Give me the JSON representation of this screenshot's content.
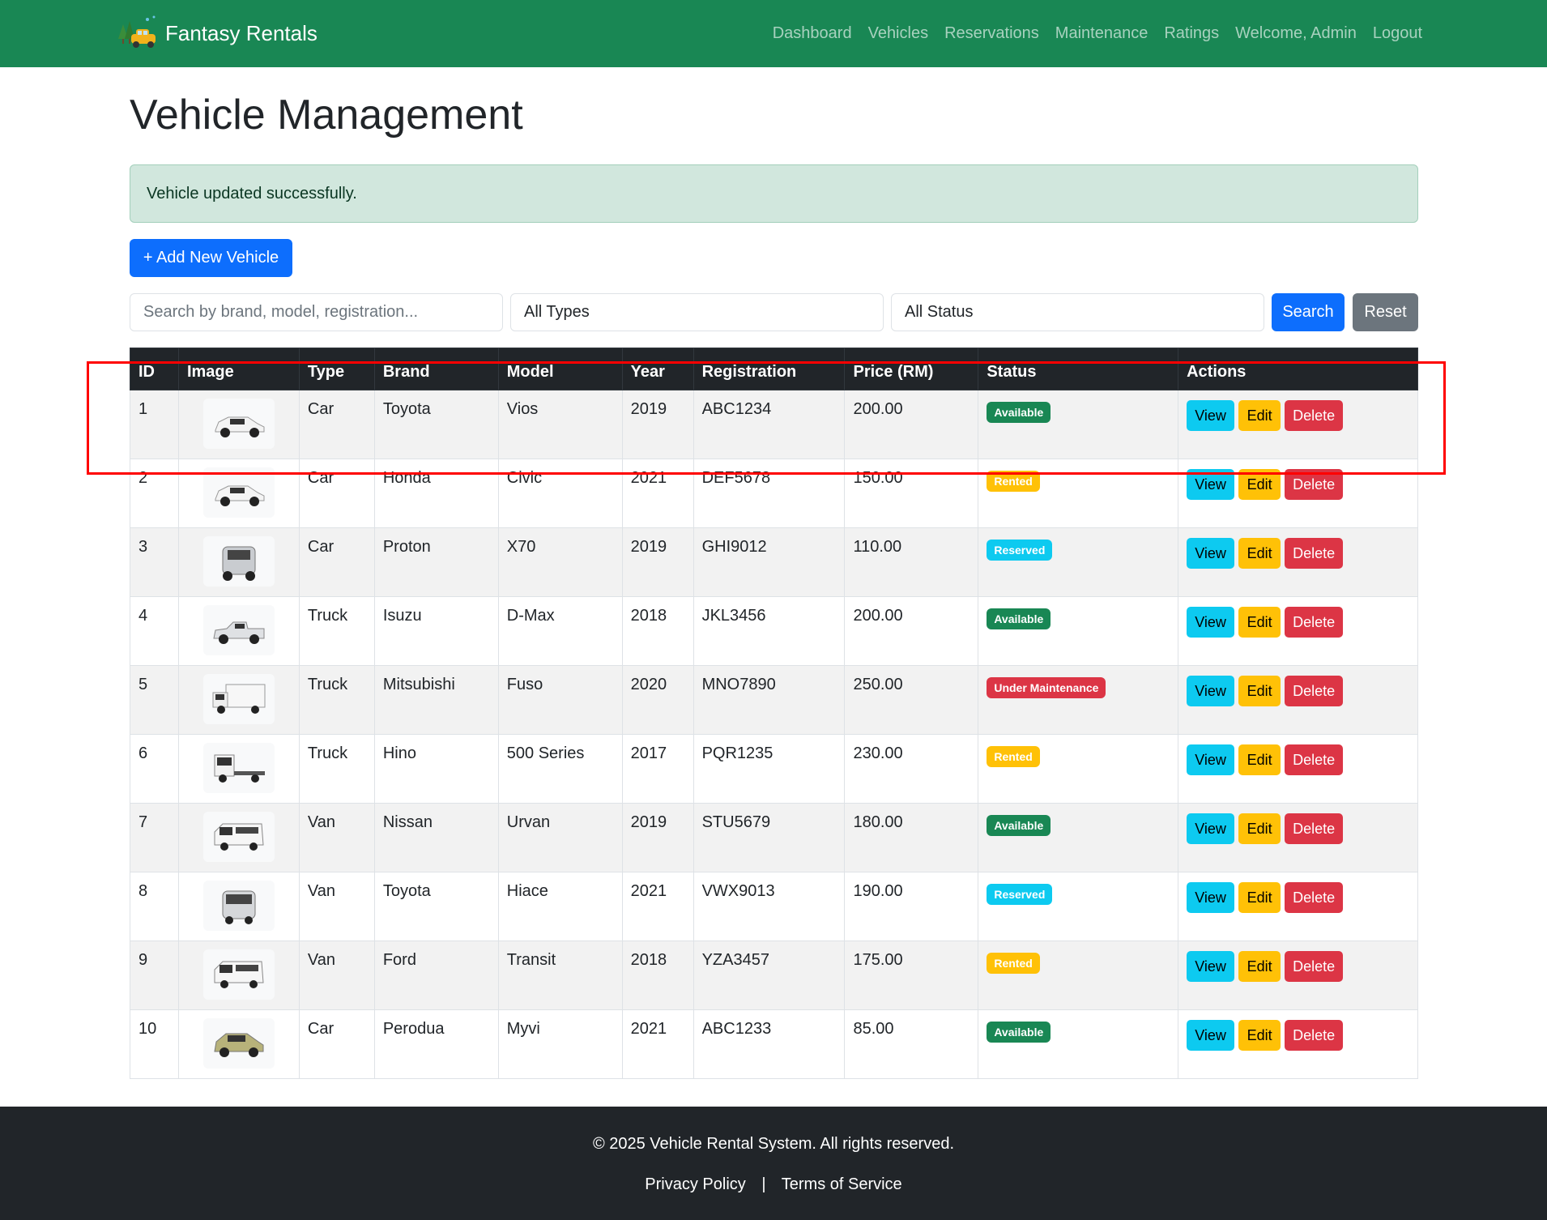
{
  "navbar": {
    "brand": "Fantasy Rentals",
    "links": [
      "Dashboard",
      "Vehicles",
      "Reservations",
      "Maintenance",
      "Ratings",
      "Welcome, Admin",
      "Logout"
    ],
    "color": "#198754"
  },
  "page": {
    "title": "Vehicle Management",
    "alert": "Vehicle updated successfully.",
    "add_button": "+ Add New Vehicle"
  },
  "filters": {
    "search_placeholder": "Search by brand, model, registration...",
    "type_value": "All Types",
    "status_value": "All Status",
    "search_button": "Search",
    "reset_button": "Reset"
  },
  "table": {
    "headers": [
      "ID",
      "Image",
      "Type",
      "Brand",
      "Model",
      "Year",
      "Registration",
      "Price (RM)",
      "Status",
      "Actions"
    ],
    "rows": [
      {
        "id": "1",
        "type": "Car",
        "brand": "Toyota",
        "model": "Vios",
        "year": "2019",
        "registration": "ABC1234",
        "price": "200.00",
        "status": "Available",
        "status_color": "green",
        "vehicle_icon": "sedan-white"
      },
      {
        "id": "2",
        "type": "Car",
        "brand": "Honda",
        "model": "Civic",
        "year": "2021",
        "registration": "DEF5678",
        "price": "150.00",
        "status": "Rented",
        "status_color": "yellow",
        "vehicle_icon": "sedan-white"
      },
      {
        "id": "3",
        "type": "Car",
        "brand": "Proton",
        "model": "X70",
        "year": "2019",
        "registration": "GHI9012",
        "price": "110.00",
        "status": "Reserved",
        "status_color": "cyan",
        "vehicle_icon": "suv-silver"
      },
      {
        "id": "4",
        "type": "Truck",
        "brand": "Isuzu",
        "model": "D-Max",
        "year": "2018",
        "registration": "JKL3456",
        "price": "200.00",
        "status": "Available",
        "status_color": "green",
        "vehicle_icon": "pickup-silver"
      },
      {
        "id": "5",
        "type": "Truck",
        "brand": "Mitsubishi",
        "model": "Fuso",
        "year": "2020",
        "registration": "MNO7890",
        "price": "250.00",
        "status": "Under Maintenance",
        "status_color": "red",
        "vehicle_icon": "box-truck"
      },
      {
        "id": "6",
        "type": "Truck",
        "brand": "Hino",
        "model": "500 Series",
        "year": "2017",
        "registration": "PQR1235",
        "price": "230.00",
        "status": "Rented",
        "status_color": "yellow",
        "vehicle_icon": "chassis-truck"
      },
      {
        "id": "7",
        "type": "Van",
        "brand": "Nissan",
        "model": "Urvan",
        "year": "2019",
        "registration": "STU5679",
        "price": "180.00",
        "status": "Available",
        "status_color": "green",
        "vehicle_icon": "van-white"
      },
      {
        "id": "8",
        "type": "Van",
        "brand": "Toyota",
        "model": "Hiace",
        "year": "2021",
        "registration": "VWX9013",
        "price": "190.00",
        "status": "Reserved",
        "status_color": "cyan",
        "vehicle_icon": "van-silver"
      },
      {
        "id": "9",
        "type": "Van",
        "brand": "Ford",
        "model": "Transit",
        "year": "2018",
        "registration": "YZA3457",
        "price": "175.00",
        "status": "Rented",
        "status_color": "yellow",
        "vehicle_icon": "van-white"
      },
      {
        "id": "10",
        "type": "Car",
        "brand": "Perodua",
        "model": "Myvi",
        "year": "2021",
        "registration": "ABC1233",
        "price": "85.00",
        "status": "Available",
        "status_color": "green",
        "vehicle_icon": "hatchback-gold"
      }
    ],
    "action_labels": {
      "view": "View",
      "edit": "Edit",
      "delete": "Delete"
    }
  },
  "footer": {
    "copyright": "© 2025 Vehicle Rental System. All rights reserved.",
    "privacy": "Privacy Policy",
    "separator": "|",
    "terms": "Terms of Service"
  }
}
